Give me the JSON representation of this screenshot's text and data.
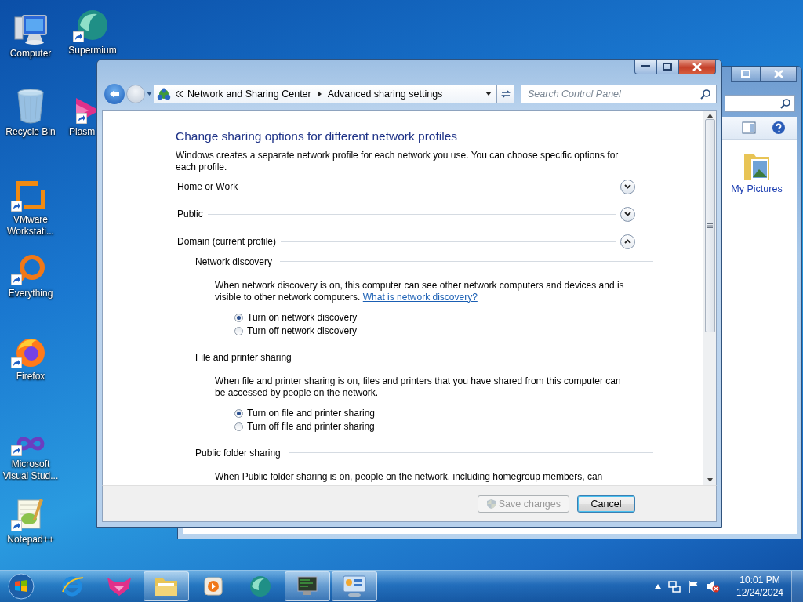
{
  "desktop_icons": [
    {
      "kind": "computer",
      "label": "Computer",
      "shortcut": false
    },
    {
      "kind": "recycle-bin",
      "label": "Recycle Bin",
      "shortcut": false
    },
    {
      "kind": "vmware",
      "label": "VMware Workstati...",
      "shortcut": true
    },
    {
      "kind": "everything",
      "label": "Everything",
      "shortcut": true
    },
    {
      "kind": "firefox",
      "label": "Firefox",
      "shortcut": true
    },
    {
      "kind": "visual-studio",
      "label": "Microsoft Visual Stud...",
      "shortcut": true
    },
    {
      "kind": "notepad",
      "label": "Notepad++",
      "shortcut": true
    },
    {
      "kind": "supermium",
      "label": "Supermium",
      "shortcut": true
    },
    {
      "kind": "plasma",
      "label": "Plasm",
      "shortcut": true
    }
  ],
  "back_window": {
    "item_label": "My Pictures"
  },
  "window": {
    "address": {
      "breadcrumbs": [
        "Network and Sharing Center",
        "Advanced sharing settings"
      ]
    },
    "search": {
      "placeholder": "Search Control Panel"
    },
    "heading": "Change sharing options for different network profiles",
    "intro": "Windows creates a separate network profile for each network you use. You can choose specific options for each profile.",
    "profiles": [
      {
        "name": "Home or Work",
        "expanded": false
      },
      {
        "name": "Public",
        "expanded": false
      },
      {
        "name": "Domain (current profile)",
        "expanded": true,
        "sections": [
          {
            "title": "Network discovery",
            "description": "When network discovery is on, this computer can see other network computers and devices and is visible to other network computers.",
            "link": "What is network discovery?",
            "options": [
              {
                "label": "Turn on network discovery",
                "selected": true
              },
              {
                "label": "Turn off network discovery",
                "selected": false
              }
            ]
          },
          {
            "title": "File and printer sharing",
            "description": "When file and printer sharing is on, files and printers that you have shared from this computer can be accessed by people on the network.",
            "options": [
              {
                "label": "Turn on file and printer sharing",
                "selected": true
              },
              {
                "label": "Turn off file and printer sharing",
                "selected": false
              }
            ]
          },
          {
            "title": "Public folder sharing",
            "description": "When Public folder sharing is on, people on the network, including homegroup members, can"
          }
        ]
      }
    ],
    "buttons": [
      {
        "label": "Save changes",
        "disabled": true,
        "kind": "shield"
      },
      {
        "label": "Cancel",
        "disabled": false,
        "kind": "plain"
      }
    ]
  },
  "taskbar": {
    "items": [
      {
        "kind": "internet-explorer",
        "active": false
      },
      {
        "kind": "fox",
        "active": false
      },
      {
        "kind": "folder",
        "active": true
      },
      {
        "kind": "media",
        "active": false
      },
      {
        "kind": "supermium",
        "active": false
      },
      {
        "kind": "monitor",
        "active": true
      },
      {
        "kind": "control-panel",
        "active": true
      }
    ],
    "time": "10:01 PM",
    "date": "12/24/2024"
  }
}
